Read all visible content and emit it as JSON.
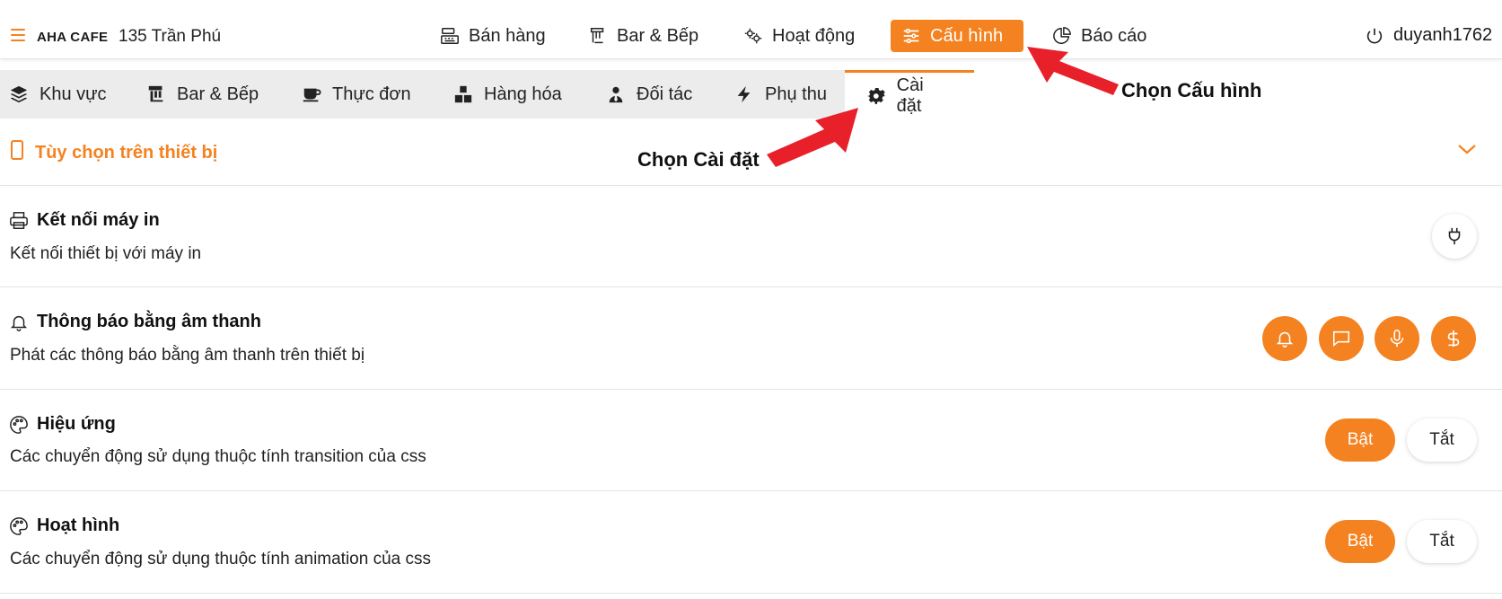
{
  "header": {
    "brand": "AHA CAFE",
    "store": "135 Trần Phú",
    "nav": [
      {
        "label": "Bán hàng",
        "icon": "cash-register-icon"
      },
      {
        "label": "Bar & Bếp",
        "icon": "kitchen-icon"
      },
      {
        "label": "Hoạt động",
        "icon": "gears-icon"
      },
      {
        "label": "Cấu hình",
        "icon": "sliders-icon",
        "active": true
      },
      {
        "label": "Báo cáo",
        "icon": "pie-chart-icon"
      }
    ],
    "user": "duyanh1762"
  },
  "subtabs": [
    {
      "label": "Khu vực",
      "icon": "layers-icon"
    },
    {
      "label": "Bar & Bếp",
      "icon": "kitchen-icon"
    },
    {
      "label": "Thực đơn",
      "icon": "coffee-cup-icon"
    },
    {
      "label": "Hàng hóa",
      "icon": "boxes-icon"
    },
    {
      "label": "Đối tác",
      "icon": "user-tie-icon"
    },
    {
      "label": "Phụ thu",
      "icon": "bolt-icon"
    },
    {
      "label": "Cài đặt",
      "icon": "gear-icon",
      "active": true
    }
  ],
  "options": {
    "title": "Tùy chọn trên thiết bị"
  },
  "rows": [
    {
      "title": "Kết nối máy in",
      "desc": "Kết nối thiết bị với máy in",
      "icon": "printer-icon"
    },
    {
      "title": "Thông báo bằng âm thanh",
      "desc": "Phát các thông báo bằng âm thanh trên thiết bị",
      "icon": "bell-icon"
    },
    {
      "title": "Hiệu ứng",
      "desc": "Các chuyển động sử dụng thuộc tính transition của css",
      "icon": "palette-icon",
      "on": "Bật",
      "off": "Tắt"
    },
    {
      "title": "Hoạt hình",
      "desc": "Các chuyển động sử dụng thuộc tính animation của css",
      "icon": "palette-icon",
      "on": "Bật",
      "off": "Tắt"
    }
  ],
  "annotations": {
    "cau_hinh": "Chọn Cấu hình",
    "cai_dat": "Chọn Cài đặt"
  },
  "colors": {
    "accent": "#f58220",
    "arrow": "#e8202a"
  }
}
